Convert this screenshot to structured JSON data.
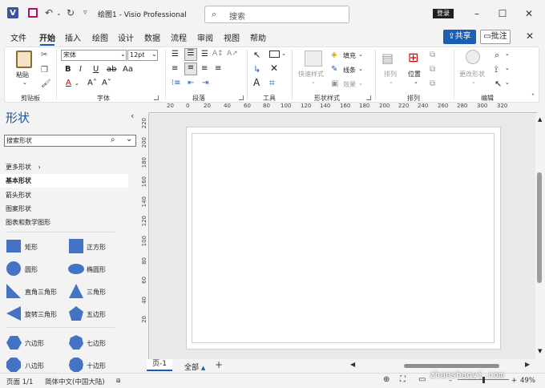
{
  "titlebar": {
    "title": "绘图1 - Visio Professional",
    "search_placeholder": "搜索",
    "signin": "登录",
    "logo_letter": "V"
  },
  "menu": {
    "tabs": [
      "文件",
      "开始",
      "插入",
      "绘图",
      "设计",
      "数据",
      "流程",
      "审阅",
      "视图",
      "帮助"
    ],
    "active": "开始",
    "share": "共享",
    "comment": "批注"
  },
  "ribbon": {
    "clipboard": {
      "paste": "粘贴",
      "label": "剪贴板"
    },
    "font": {
      "family": "宋体",
      "size": "12pt",
      "label": "字体"
    },
    "paragraph": {
      "label": "段落"
    },
    "tools": {
      "label": "工具"
    },
    "shape_styles": {
      "quick": "快速样式",
      "fill": "填充",
      "line": "线条",
      "effect": "效果",
      "label": "形状样式"
    },
    "arrange": {
      "arrange": "排列",
      "position": "位置",
      "label": "排列"
    },
    "editing": {
      "change_shape": "更改形状",
      "label": "编辑"
    }
  },
  "panel": {
    "title": "形状",
    "search_placeholder": "搜索形状",
    "items": [
      "更多形状",
      "基本形状",
      "箭头形状",
      "图案形状",
      "图表和数学图形"
    ],
    "selected": "基本形状",
    "shapes": [
      [
        "矩形",
        "正方形"
      ],
      [
        "圆形",
        "椭圆形"
      ],
      [
        "直角三角形",
        "三角形"
      ],
      [
        "旋转三角形",
        "五边形"
      ],
      [
        "六边形",
        "七边形"
      ],
      [
        "八边形",
        "十边形"
      ]
    ]
  },
  "ruler": {
    "h_ticks": [
      "20",
      "0",
      "20",
      "40",
      "60",
      "80",
      "100",
      "120",
      "140",
      "160",
      "180",
      "200",
      "220",
      "240",
      "260",
      "280",
      "300",
      "320"
    ],
    "v_ticks": [
      "220",
      "200",
      "180",
      "160",
      "140",
      "120",
      "100",
      "80",
      "60",
      "40",
      "20"
    ]
  },
  "pages": {
    "tabs": [
      "页-1"
    ],
    "all": "全部"
  },
  "status": {
    "page": "页面 1/1",
    "language": "简体中文(中国大陆)",
    "zoom": "49%",
    "watermark": "zhanshaoyi.com"
  }
}
